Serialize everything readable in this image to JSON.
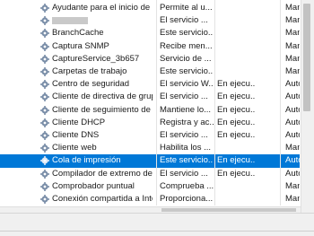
{
  "services": [
    {
      "name": "Ayudante para el inicio de s...",
      "description": "Permite al u...",
      "status": "",
      "startup": "Manu"
    },
    {
      "name": "",
      "description": "El servicio ...",
      "status": "",
      "startup": "Manu"
    },
    {
      "name": "BranchCache",
      "description": "Este servicio...",
      "status": "",
      "startup": "Manu"
    },
    {
      "name": "Captura SNMP",
      "description": "Recibe men...",
      "status": "",
      "startup": "Manu"
    },
    {
      "name": "CaptureService_3b657",
      "description": "Servicio de ...",
      "status": "",
      "startup": "Manu"
    },
    {
      "name": "Carpetas de trabajo",
      "description": "Este servicio...",
      "status": "",
      "startup": "Manu"
    },
    {
      "name": "Centro de seguridad",
      "description": "El servicio W...",
      "status": "En ejecu...",
      "startup": "Auto"
    },
    {
      "name": "Cliente de directiva de grupo",
      "description": "El servicio ...",
      "status": "En ejecu...",
      "startup": "Auto"
    },
    {
      "name": "Cliente de seguimiento de v...",
      "description": "Mantiene lo...",
      "status": "En ejecu...",
      "startup": "Auto"
    },
    {
      "name": "Cliente DHCP",
      "description": "Registra y ac...",
      "status": "En ejecu...",
      "startup": "Auto"
    },
    {
      "name": "Cliente DNS",
      "description": "El servicio ...",
      "status": "En ejecu...",
      "startup": "Auto"
    },
    {
      "name": "Cliente web",
      "description": "Habilita los ...",
      "status": "",
      "startup": "Manu"
    },
    {
      "name": "Cola de impresión",
      "description": "Este servicio...",
      "status": "En ejecu...",
      "startup": "Auto"
    },
    {
      "name": "Compilador de extremo de ...",
      "description": "El servicio ...",
      "status": "En ejecu...",
      "startup": "Auto"
    },
    {
      "name": "Comprobador puntual",
      "description": "Comprueba ...",
      "status": "",
      "startup": "Manu"
    },
    {
      "name": "Conexión compartida a Inte...",
      "description": "Proporciona...",
      "status": "",
      "startup": "Manu"
    }
  ],
  "selected_index": 12,
  "colors": {
    "selection": "#0078d7",
    "gear": "#7a8ea8"
  }
}
